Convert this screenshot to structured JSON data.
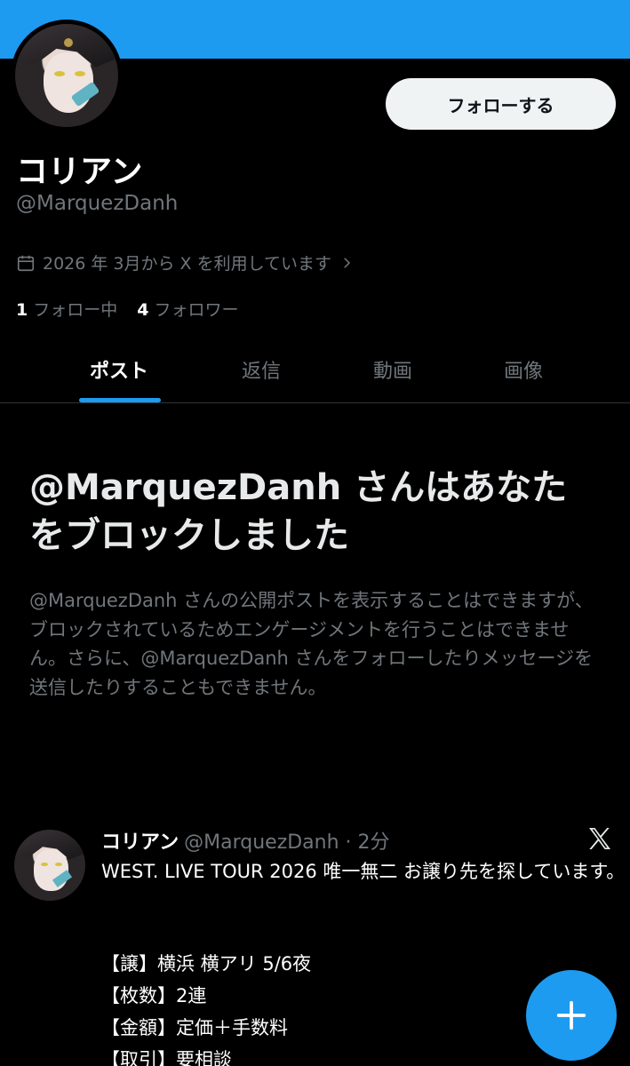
{
  "profile": {
    "display_name": "コリアン",
    "handle": "@MarquezDanh",
    "joined": "2026 年 3月から X を利用しています",
    "following_count": "1",
    "following_label": "フォロー中",
    "followers_count": "4",
    "followers_label": "フォロワー",
    "follow_button": "フォローする"
  },
  "tabs": [
    {
      "label": "ポスト",
      "active": true
    },
    {
      "label": "返信",
      "active": false
    },
    {
      "label": "動画",
      "active": false
    },
    {
      "label": "画像",
      "active": false
    }
  ],
  "block_notice": {
    "title": "@MarquezDanh さんはあなたをブロックしました",
    "body": "@MarquezDanh さんの公開ポストを表示することはできますが、ブロックされているためエンゲージメントを行うことはできません。さらに、@MarquezDanh さんをフォローしたりメッセージを送信したりすることもできません。"
  },
  "post": {
    "author_name": "コリアン",
    "author_meta": "@MarquezDanh · 2分",
    "text": "WEST. LIVE TOUR 2026 唯一無二 お譲り先を探しています。",
    "details": [
      "【譲】横浜 横アリ 5/6夜",
      "【枚数】2連",
      "【金額】定価＋手数料",
      "【取引】要相談"
    ]
  },
  "colors": {
    "accent": "#1d9bf0",
    "background": "#000000",
    "muted_text": "#71767b"
  },
  "icons": [
    "calendar-icon",
    "chevron-right-icon",
    "x-logo-icon",
    "plus-icon"
  ]
}
